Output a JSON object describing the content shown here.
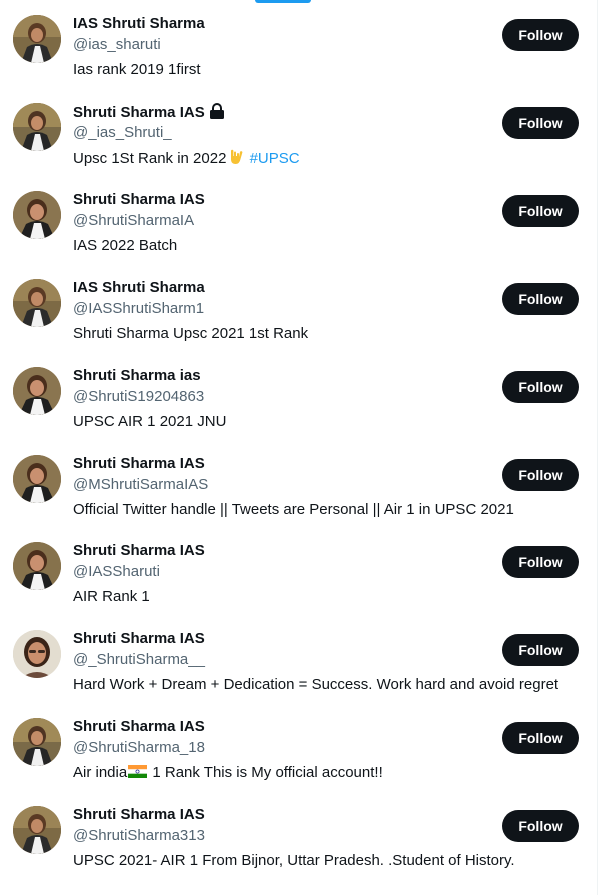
{
  "colors": {
    "accent": "#1d9bf0",
    "text_primary": "#0f1419",
    "text_secondary": "#536471",
    "button_bg": "#0f1419",
    "button_text": "#ffffff"
  },
  "users": [
    {
      "display_name": "IAS Shruti Sharma",
      "handle": "@ias_sharuti",
      "bio": "Ias rank 2019 1first",
      "follow_label": "Follow",
      "avatar_icon": "avatar-photo-icon"
    },
    {
      "display_name": "Shruti Sharma IAS",
      "handle": "@_ias_Shruti_",
      "bio_text": "Upsc 1St Rank in 2022",
      "bio_emoji": "love-you-gesture-icon",
      "bio_hashtag": "#UPSC",
      "follow_label": "Follow",
      "badge_icon": "lock-icon",
      "avatar_icon": "avatar-photo-icon"
    },
    {
      "display_name": "Shruti Sharma IAS",
      "handle": "@ShrutiSharmaIA",
      "bio": "IAS 2022 Batch",
      "follow_label": "Follow",
      "avatar_icon": "avatar-photo-icon"
    },
    {
      "display_name": "IAS Shruti Sharma",
      "handle": "@IASShrutiSharm1",
      "bio": "Shruti Sharma Upsc 2021 1st Rank",
      "follow_label": "Follow",
      "avatar_icon": "avatar-photo-icon"
    },
    {
      "display_name": "Shruti Sharma ias",
      "handle": "@ShrutiS19204863",
      "bio": "UPSC AIR 1 2021 JNU",
      "follow_label": "Follow",
      "avatar_icon": "avatar-photo-icon"
    },
    {
      "display_name": "Shruti Sharma IAS",
      "handle": "@MShrutiSarmaIAS",
      "bio": "Official Twitter handle || Tweets are Personal || Air 1 in UPSC 2021",
      "follow_label": "Follow",
      "avatar_icon": "avatar-photo-icon"
    },
    {
      "display_name": "Shruti Sharma IAS",
      "handle": "@IASSharuti",
      "bio": "AIR Rank 1",
      "follow_label": "Follow",
      "avatar_icon": "avatar-photo-icon"
    },
    {
      "display_name": "Shruti Sharma IAS",
      "handle": "@_ShrutiSharma__",
      "bio": "Hard Work + Dream + Dedication = Success. Work hard and avoid regret",
      "follow_label": "Follow",
      "avatar_icon": "avatar-photo-icon"
    },
    {
      "display_name": "Shruti Sharma IAS",
      "handle": "@ShrutiSharma_18",
      "bio_before": "Air india",
      "bio_emoji": "india-flag-icon",
      "bio_after": " 1 Rank This is My official account!!",
      "follow_label": "Follow",
      "avatar_icon": "avatar-photo-icon"
    },
    {
      "display_name": "Shruti Sharma IAS",
      "handle": "@ShrutiSharma313",
      "bio": "UPSC 2021- AIR 1 From Bijnor, Uttar Pradesh. .Student of History.",
      "follow_label": "Follow",
      "avatar_icon": "avatar-photo-icon"
    }
  ]
}
